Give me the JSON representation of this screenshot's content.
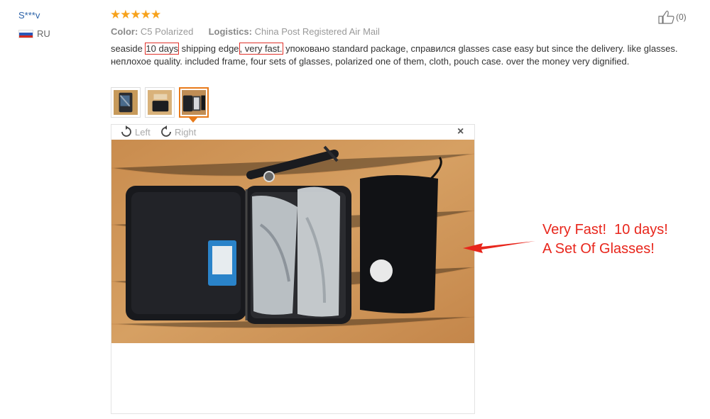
{
  "reviewer": {
    "name": "S***v",
    "country": "RU"
  },
  "rating": {
    "stars": "★★★★★",
    "value": 5,
    "max": 5,
    "color": "#f7a21b"
  },
  "meta": {
    "color_label": "Color:",
    "color_value": "C5 Polarized",
    "logistics_label": "Logistics:",
    "logistics_value": "China Post Registered Air Mail"
  },
  "review": {
    "seg1": "seaside ",
    "highlight1": "10 days",
    "seg2": " shipping edge",
    "highlight2": ", very fast.",
    "seg3": " упоковано standard package, справился glasses case easy but since the delivery. like glasses. неплохое quality. included frame, four sets of glasses, polarized one of them, cloth, pouch case. over the money very dignified."
  },
  "helpful": {
    "icon": "thumbs-up-icon",
    "count": "(0)"
  },
  "thumbnails": [
    {
      "name": "thumbnail-1",
      "active": false
    },
    {
      "name": "thumbnail-2",
      "active": false
    },
    {
      "name": "thumbnail-3",
      "active": true
    }
  ],
  "viewer": {
    "rotate_left": "Left",
    "rotate_right": "Right",
    "close": "×"
  },
  "annotation": {
    "text": "Very Fast!  10 days!\nA Set Of Glasses!",
    "color": "#e8261c"
  }
}
